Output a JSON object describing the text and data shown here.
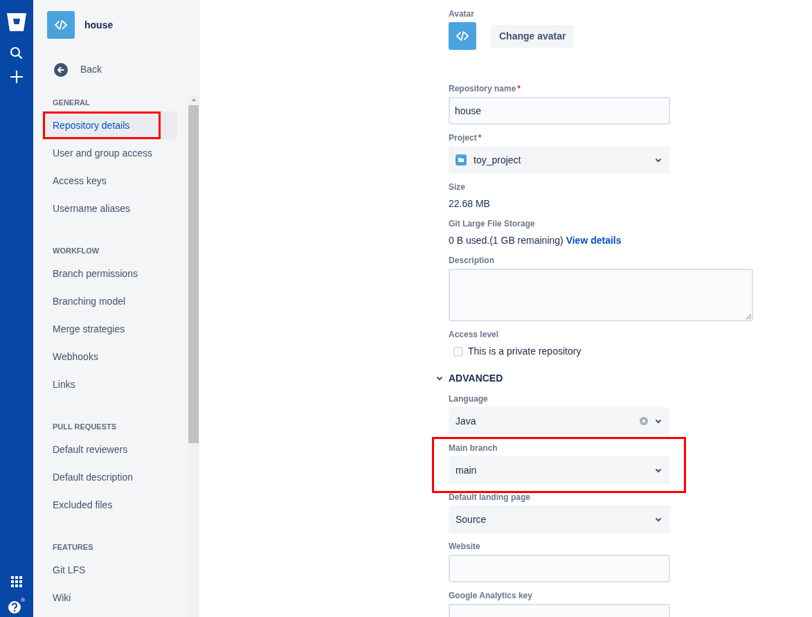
{
  "repo": {
    "name": "house"
  },
  "back": {
    "label": "Back"
  },
  "sidebar": {
    "sections": [
      {
        "heading": "GENERAL",
        "items": [
          {
            "label": "Repository details",
            "selected": true,
            "annotated": true
          },
          {
            "label": "User and group access",
            "selected": false,
            "annotated": false
          },
          {
            "label": "Access keys",
            "selected": false,
            "annotated": false
          },
          {
            "label": "Username aliases",
            "selected": false,
            "annotated": false
          }
        ]
      },
      {
        "heading": "WORKFLOW",
        "items": [
          {
            "label": "Branch permissions",
            "selected": false,
            "annotated": false
          },
          {
            "label": "Branching model",
            "selected": false,
            "annotated": false
          },
          {
            "label": "Merge strategies",
            "selected": false,
            "annotated": false
          },
          {
            "label": "Webhooks",
            "selected": false,
            "annotated": false
          },
          {
            "label": "Links",
            "selected": false,
            "annotated": false
          }
        ]
      },
      {
        "heading": "PULL REQUESTS",
        "items": [
          {
            "label": "Default reviewers",
            "selected": false,
            "annotated": false
          },
          {
            "label": "Default description",
            "selected": false,
            "annotated": false
          },
          {
            "label": "Excluded files",
            "selected": false,
            "annotated": false
          }
        ]
      },
      {
        "heading": "FEATURES",
        "items": [
          {
            "label": "Git LFS",
            "selected": false,
            "annotated": false
          },
          {
            "label": "Wiki",
            "selected": false,
            "annotated": false
          }
        ]
      }
    ]
  },
  "avatar": {
    "label": "Avatar",
    "button": "Change avatar"
  },
  "fields": [
    {
      "kind": "text",
      "label": "Repository name",
      "required_mark": "*",
      "value": "house",
      "annotated": false
    },
    {
      "kind": "project-select",
      "label": "Project",
      "required_mark": "*",
      "value": "toy_project",
      "annotated": false
    },
    {
      "kind": "info",
      "label": "Size",
      "value": "22.68 MB",
      "annotated": false
    },
    {
      "kind": "info",
      "label": "Git Large File Storage",
      "value": "0 B used.(1 GB remaining)",
      "link": "View details",
      "annotated": false
    },
    {
      "kind": "textarea",
      "label": "Description",
      "annotated": false
    },
    {
      "kind": "checkbox",
      "label": "Access level",
      "option": "This is a private repository",
      "checked": false,
      "annotated": false
    },
    {
      "kind": "section",
      "label": "ADVANCED",
      "expanded": true,
      "annotated": false
    },
    {
      "kind": "select",
      "label": "Language",
      "value": "Java",
      "clearable": true,
      "annotated": false
    },
    {
      "kind": "select",
      "label": "Main branch",
      "value": "main",
      "clearable": false,
      "annotated": true
    },
    {
      "kind": "select",
      "label": "Default landing page",
      "value": "Source",
      "clearable": false,
      "annotated": false
    },
    {
      "kind": "text",
      "label": "Website",
      "annotated": false
    },
    {
      "kind": "text",
      "label": "Google Analytics key",
      "annotated": false
    }
  ]
}
